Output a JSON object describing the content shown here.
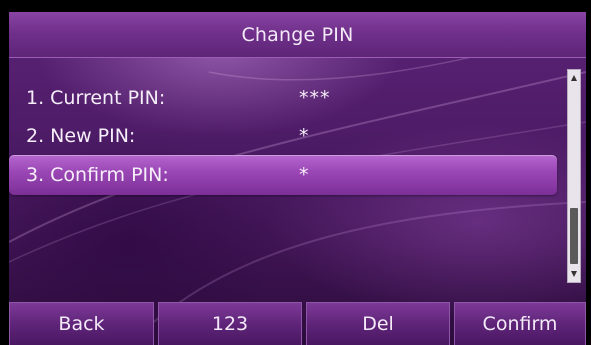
{
  "title": "Change PIN",
  "fields": [
    {
      "label": "1. Current PIN:",
      "value": "***",
      "selected": false
    },
    {
      "label": "2. New PIN:",
      "value": "*",
      "selected": false
    },
    {
      "label": "3. Confirm PIN:",
      "value": "*",
      "selected": true
    }
  ],
  "softkeys": {
    "back": "Back",
    "input_mode": "123",
    "delete": "Del",
    "confirm": "Confirm"
  },
  "scrollbar": {
    "up_icon": "triangle-up-icon",
    "down_icon": "triangle-down-icon"
  },
  "colors": {
    "background": "#4e1c68",
    "selected_row": "#9b48b6",
    "text": "#f6eef9"
  }
}
